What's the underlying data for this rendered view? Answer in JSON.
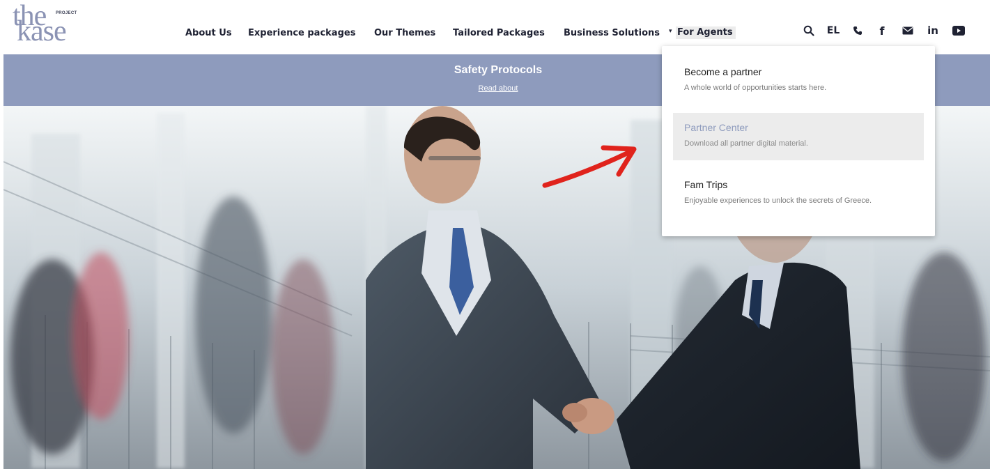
{
  "logo": {
    "line1": "the",
    "line2": "kase",
    "badge": "PROJECT"
  },
  "nav": {
    "items": [
      {
        "label": "About Us"
      },
      {
        "label": "Experience packages"
      },
      {
        "label": "Our Themes"
      },
      {
        "label": "Tailored Packages"
      },
      {
        "label": "Business Solutions"
      },
      {
        "label": "For Agents"
      }
    ],
    "caret_glyph": "▾"
  },
  "header_icons": [
    {
      "name": "search-icon",
      "glyph": "🔍"
    },
    {
      "name": "language-switch",
      "glyph": "EL"
    },
    {
      "name": "phone-icon",
      "glyph": "📞"
    },
    {
      "name": "facebook-icon",
      "glyph": "f"
    },
    {
      "name": "mail-icon",
      "glyph": "✉"
    },
    {
      "name": "linkedin-icon",
      "glyph": "in"
    },
    {
      "name": "youtube-icon",
      "glyph": "▶"
    }
  ],
  "banner": {
    "title": "Safety Protocols",
    "link": "Read about"
  },
  "dropdown": {
    "items": [
      {
        "title": "Become a partner",
        "subtitle": "A whole world of opportunities starts here."
      },
      {
        "title": "Partner Center",
        "subtitle": "Download all partner digital material."
      },
      {
        "title": "Fam Trips",
        "subtitle": "Enjoyable experiences to unlock the secrets of Greece."
      }
    ]
  },
  "colors": {
    "brand": "#8e9bbd",
    "annotation_arrow": "#e0231c",
    "nav_text": "#1f2233"
  }
}
